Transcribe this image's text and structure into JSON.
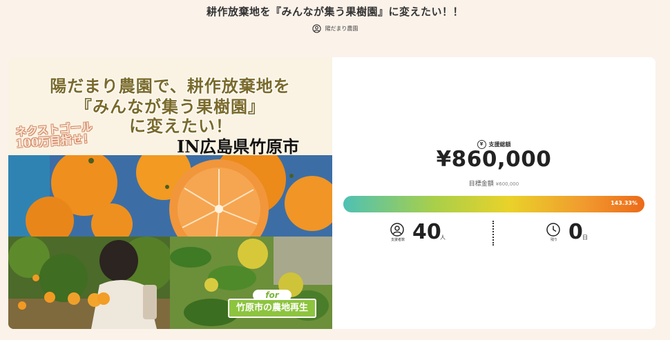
{
  "header": {
    "title": "耕作放棄地を『みんなが集う果樹園』に変えたい！！",
    "owner": "陽だまり農園"
  },
  "hero": {
    "line1": "陽だまり農園で、耕作放棄地を",
    "line2": "『みんなが集う果樹園』",
    "line3": "に変えたい！",
    "next_goal_line1": "ネクストゴール",
    "next_goal_line2": "100万目指せ！",
    "location": "IN広島県竹原市",
    "for_label": "for",
    "for_text": "竹原市の農地再生"
  },
  "stats": {
    "raised_label": "支援総額",
    "raised_amount": "¥860,000",
    "target_label": "目標金額",
    "target_amount": "¥600,000",
    "progress_text": "143.33%",
    "progress_percent": 143.33,
    "supporters_label": "支援者数",
    "supporters_count": "40",
    "supporters_unit": "人",
    "days_label": "残り",
    "days_count": "0",
    "days_unit": "日"
  },
  "colors": {
    "background": "#fbf2ea",
    "progress_start": "#4ec1b4",
    "progress_end": "#ec6a19",
    "badge_green": "#8dc43f"
  }
}
